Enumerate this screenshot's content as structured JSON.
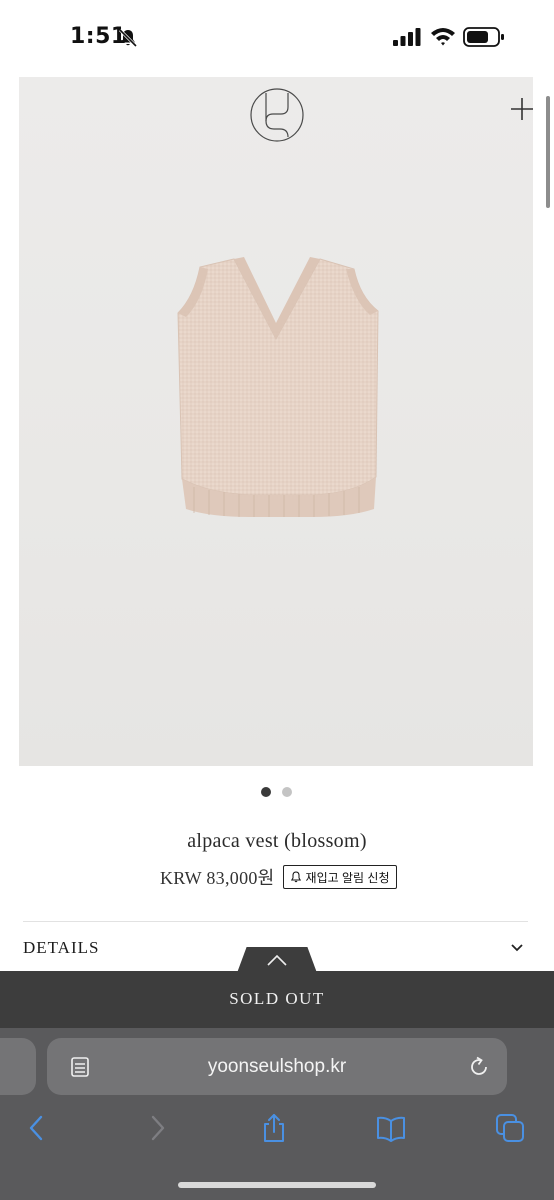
{
  "status_bar": {
    "time": "1:51",
    "icons": [
      "silent-bell-icon",
      "cellular-signal-icon",
      "wifi-icon",
      "battery-icon"
    ]
  },
  "hero": {
    "logo_icon": "brand-monogram-logo",
    "menu_icon": "plus-icon",
    "image_subject": "knit-vest-image",
    "carousel": {
      "total": 2,
      "active_index": 0
    }
  },
  "product": {
    "name": "alpaca vest (blossom)",
    "price": "KRW 83,000원",
    "restock_button_label": "재입고 알림 신청",
    "restock_icon": "bell-icon"
  },
  "details": {
    "label": "DETAILS",
    "icon": "chevron-down-icon"
  },
  "purchase_bar": {
    "label": "SOLD OUT",
    "tab_icon": "chevron-up-icon"
  },
  "browser": {
    "url": "yoonseulshop.kr",
    "icons": [
      "reader-icon",
      "reload-icon",
      "back-icon",
      "forward-icon",
      "share-icon",
      "bookmarks-icon",
      "tabs-icon"
    ]
  },
  "colors": {
    "hero_background": "#e9e8e6",
    "garment": "#e8d5c9",
    "soldout_bar": "#3d3d3d",
    "toolbar": "#5a5a5c",
    "toolbar_accent": "#4a90e2"
  }
}
